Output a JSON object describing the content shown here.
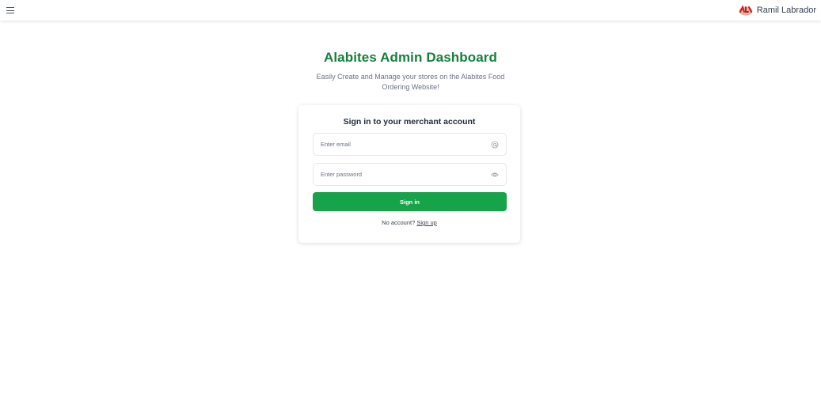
{
  "topbar": {
    "menu_icon": "hamburger-menu-icon",
    "user_name": "Ramil Labrador",
    "logo_icon": "alabites-logo-icon"
  },
  "header": {
    "title": "Alabites Admin Dashboard",
    "subtitle": "Easily Create and Manage your stores on the Alabites Food Ordering Website!"
  },
  "login_card": {
    "title": "Sign in to your merchant account",
    "email": {
      "value": "",
      "placeholder": "Enter email",
      "icon": "at-sign-icon"
    },
    "password": {
      "value": "",
      "placeholder": "Enter password",
      "icon": "eye-icon"
    },
    "submit_label": "Sign in",
    "no_account_text": "No account?",
    "signup_link": "Sign up"
  },
  "colors": {
    "brand_green": "#15803d",
    "button_green": "#16a34a",
    "text_gray": "#6b7280"
  }
}
